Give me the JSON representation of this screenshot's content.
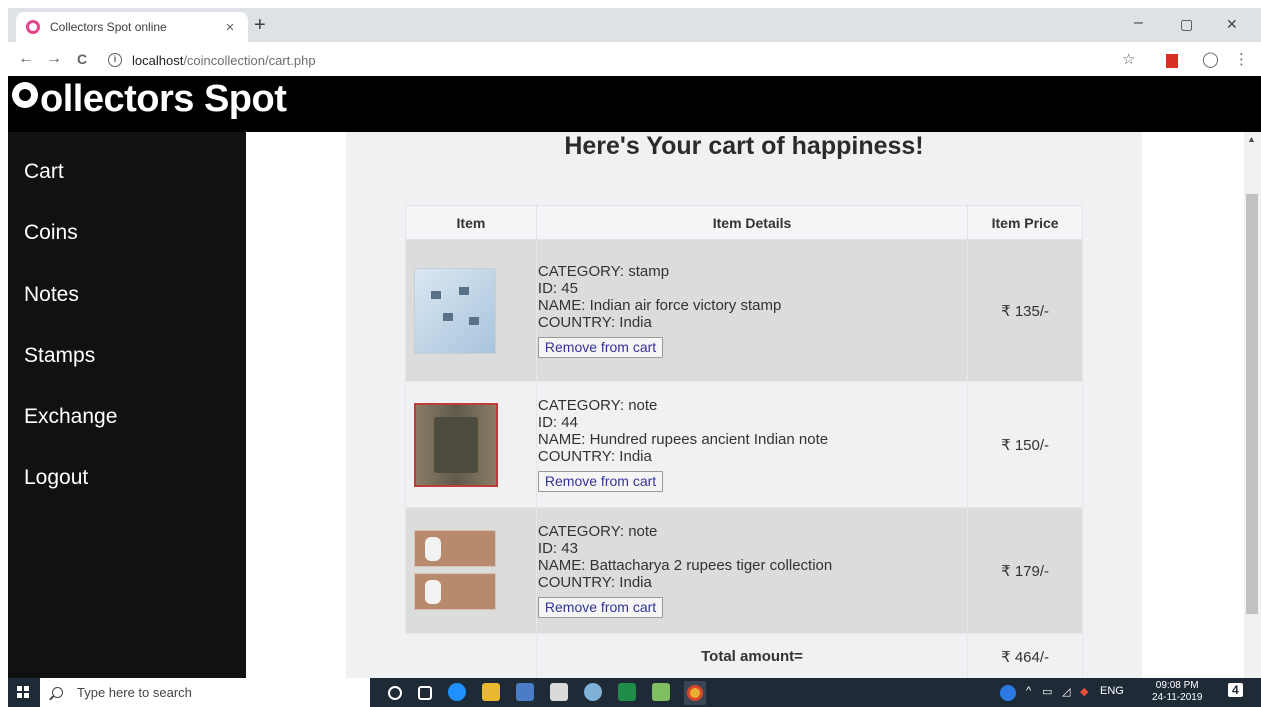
{
  "browser": {
    "tab_title": "Collectors Spot online",
    "tab_close": "×",
    "new_tab": "+",
    "url_host": "localhost",
    "url_path": "/coincollection/cart.php",
    "back": "←",
    "forward": "→",
    "reload": "C",
    "star": "☆",
    "profile": "◯",
    "menu": "⋮",
    "minimize": "–",
    "restore": "▢",
    "close": "✕"
  },
  "header": {
    "logo_text": "ollectors Spot"
  },
  "sidebar": {
    "items": [
      {
        "label": "Cart"
      },
      {
        "label": "Coins"
      },
      {
        "label": "Notes"
      },
      {
        "label": "Stamps"
      },
      {
        "label": "Exchange"
      },
      {
        "label": "Logout"
      }
    ]
  },
  "main": {
    "heading": "Here's Your cart of happiness!",
    "columns": [
      "Item",
      "Item Details",
      "Item Price"
    ],
    "rows": [
      {
        "category": "CATEGORY: stamp",
        "id": "ID: 45",
        "name": "NAME: Indian air force victory stamp",
        "country": "COUNTRY: India",
        "price": "₹ 135/-",
        "button": "Remove from cart"
      },
      {
        "category": "CATEGORY: note",
        "id": "ID: 44",
        "name": "NAME: Hundred rupees ancient Indian note",
        "country": "COUNTRY: India",
        "price": "₹ 150/-",
        "button": "Remove from cart"
      },
      {
        "category": "CATEGORY: note",
        "id": "ID: 43",
        "name": "NAME: Battacharya 2 rupees tiger collection",
        "country": "COUNTRY: India",
        "price": "₹ 179/-",
        "button": "Remove from cart"
      }
    ],
    "total_label": "Total amount=",
    "total_value": "₹ 464/-"
  },
  "taskbar": {
    "search_placeholder": "Type here to search",
    "language": "ENG",
    "time": "09:08 PM",
    "date": "24-11-2019",
    "notifications": "4"
  },
  "colors": {
    "sidebar": "#111111",
    "header": "#000000",
    "main_bg": "#f0f1f3",
    "row_shade": "#dcdcdc",
    "button_text": "#333399"
  }
}
